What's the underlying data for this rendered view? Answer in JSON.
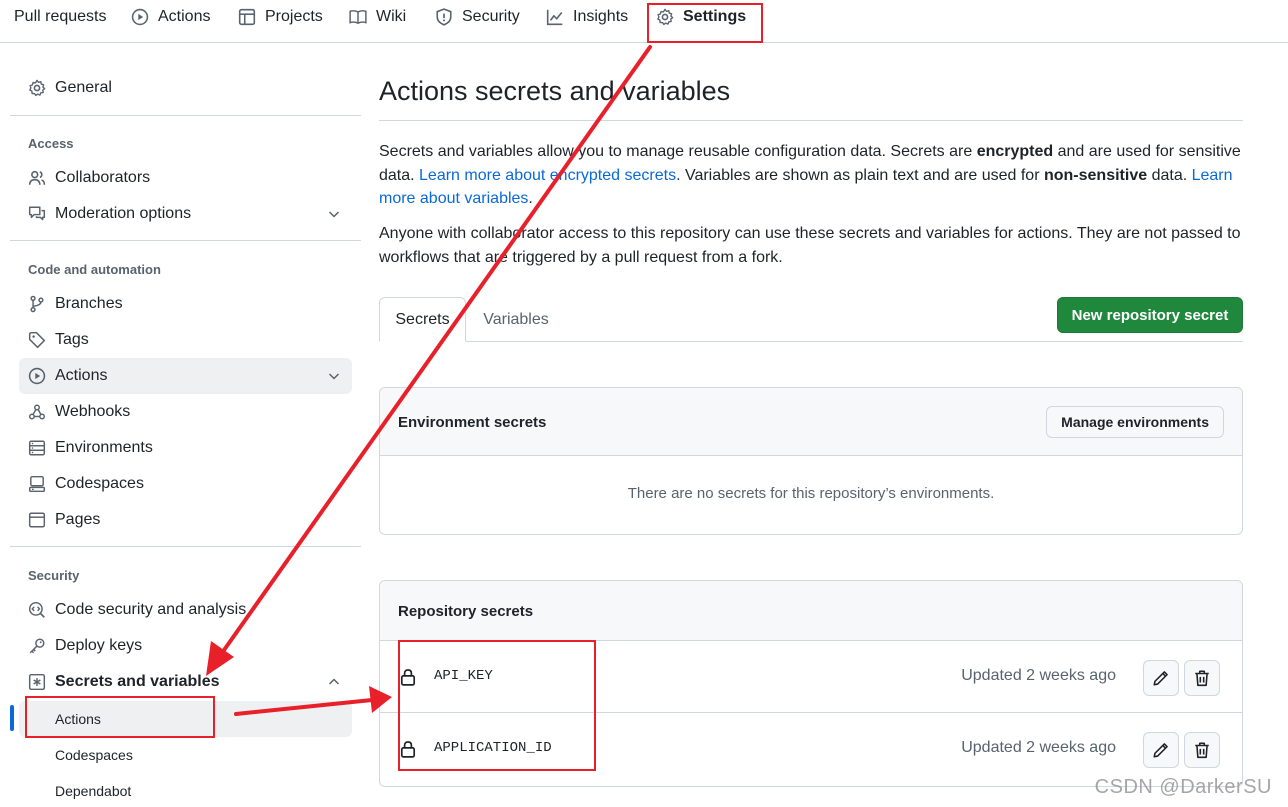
{
  "topnav": {
    "items": [
      {
        "label": "Pull requests",
        "icon": "pull-request-icon"
      },
      {
        "label": "Actions",
        "icon": "play-icon"
      },
      {
        "label": "Projects",
        "icon": "table-icon"
      },
      {
        "label": "Wiki",
        "icon": "book-icon"
      },
      {
        "label": "Security",
        "icon": "shield-icon"
      },
      {
        "label": "Insights",
        "icon": "graph-icon"
      },
      {
        "label": "Settings",
        "icon": "gear-icon",
        "selected": true
      }
    ]
  },
  "sidebar": {
    "general": "General",
    "access_heading": "Access",
    "collaborators": "Collaborators",
    "moderation": "Moderation options",
    "code_heading": "Code and automation",
    "branches": "Branches",
    "tags": "Tags",
    "actions": "Actions",
    "webhooks": "Webhooks",
    "environments": "Environments",
    "codespaces": "Codespaces",
    "pages": "Pages",
    "security_heading": "Security",
    "code_security": "Code security and analysis",
    "deploy_keys": "Deploy keys",
    "secrets_vars": "Secrets and variables",
    "sub_actions": "Actions",
    "sub_codespaces": "Codespaces",
    "sub_dependabot": "Dependabot"
  },
  "main": {
    "title": "Actions secrets and variables",
    "p1_a": "Secrets and variables allow you to manage reusable configuration data. Secrets are ",
    "p1_b": "encrypted",
    "p1_c": " and are used for sensitive data. ",
    "p1_link1": "Learn more about encrypted secrets",
    "p1_d": ". Variables are shown as plain text and are used for ",
    "p1_e": "non-sensitive",
    "p1_f": " data. ",
    "p1_link2": "Learn more about variables",
    "p1_g": ".",
    "p2": "Anyone with collaborator access to this repository can use these secrets and variables for actions. They are not passed to workflows that are triggered by a pull request from a fork.",
    "tab_secrets": "Secrets",
    "tab_variables": "Variables",
    "new_secret_button": "New repository secret",
    "env_title": "Environment secrets",
    "manage_env_button": "Manage environments",
    "env_empty": "There are no secrets for this repository’s environments.",
    "repo_title": "Repository secrets",
    "secrets": [
      {
        "name": "API_KEY",
        "updated": "Updated 2 weeks ago"
      },
      {
        "name": "APPLICATION_ID",
        "updated": "Updated 2 weeks ago"
      }
    ]
  },
  "watermark": "CSDN @DarkerSU",
  "colors": {
    "accent_blue": "#0969da",
    "primary_green": "#1f883d",
    "annotation_red": "#e8202a"
  }
}
